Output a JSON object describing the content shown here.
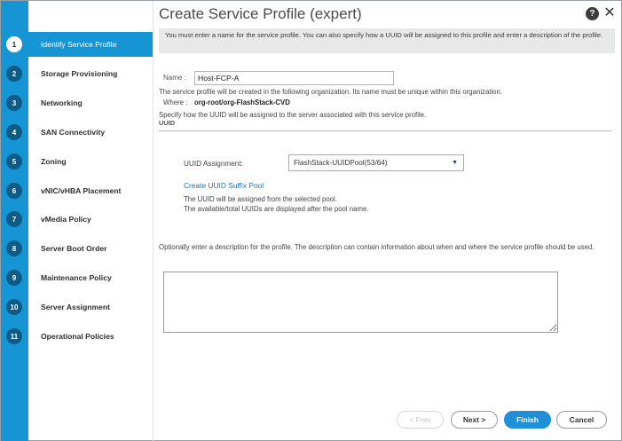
{
  "window": {
    "title": "Create Service Profile (expert)",
    "help_label": "?",
    "close_label": "✕"
  },
  "steps": [
    {
      "num": "1",
      "label": "Identify Service Profile"
    },
    {
      "num": "2",
      "label": "Storage Provisioning"
    },
    {
      "num": "3",
      "label": "Networking"
    },
    {
      "num": "4",
      "label": "SAN Connectivity"
    },
    {
      "num": "5",
      "label": "Zoning"
    },
    {
      "num": "6",
      "label": "vNIC/vHBA Placement"
    },
    {
      "num": "7",
      "label": "vMedia Policy"
    },
    {
      "num": "8",
      "label": "Server Boot Order"
    },
    {
      "num": "9",
      "label": "Maintenance Policy"
    },
    {
      "num": "10",
      "label": "Server Assignment"
    },
    {
      "num": "11",
      "label": "Operational Policies"
    }
  ],
  "intro": {
    "text": "You must enter a name for the service profile. You can also specify how a UUID will be assigned to this profile and enter a description of the profile."
  },
  "name": {
    "label": "Name  :",
    "value": "Host-FCP-A"
  },
  "org": {
    "note": "The service profile will be created in the following organization. Its name must be unique within this organization.",
    "where_label": "Where :",
    "where_value": "org-root/org-FlashStack-CVD"
  },
  "uuid": {
    "intro": "Specify how the UUID will be assigned to the server associated with this service profile.",
    "section_title": "UUID",
    "assignment_label": "UUID Assignment:",
    "assignment_value": "FlashStack-UUIDPool(53/64)",
    "create_link": "Create UUID Suffix Pool",
    "note_1": "The UUID will be assigned from the selected pool.",
    "note_2": "The available/total UUIDs are displayed after the pool name."
  },
  "description": {
    "prompt": "Optionally enter a description for the profile. The description can contain information about when and where the service profile should be used.",
    "value": ""
  },
  "footer": {
    "prev_label": "< Prev",
    "next_label": "Next >",
    "finish_label": "Finish",
    "cancel_label": "Cancel"
  },
  "colors": {
    "accent": "#1595d3",
    "finish_button": "#1f8fd6",
    "step_circle": "#0d5c88"
  }
}
